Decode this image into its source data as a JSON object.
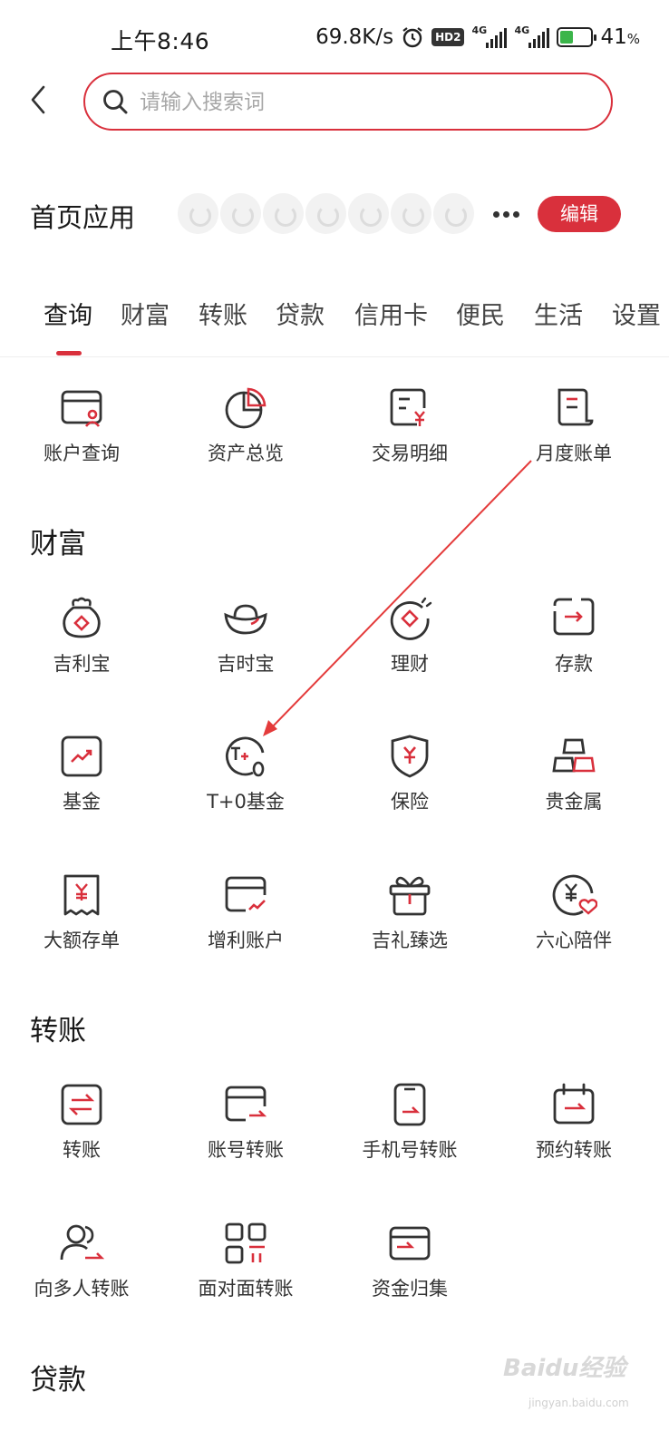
{
  "status_bar": {
    "time": "上午8:46",
    "net_speed": "69.8K/s",
    "hd_badge": "HD2",
    "signal_1_label": "4G",
    "signal_2_label": "4G",
    "battery_percent": "41",
    "battery_unit": "%",
    "battery_level": 0.41
  },
  "search": {
    "placeholder": "请输入搜索词"
  },
  "home_apps": {
    "title": "首页应用",
    "edit_label": "编辑"
  },
  "tabs": [
    {
      "label": "查询"
    },
    {
      "label": "财富"
    },
    {
      "label": "转账"
    },
    {
      "label": "贷款"
    },
    {
      "label": "信用卡"
    },
    {
      "label": "便民"
    },
    {
      "label": "生活"
    },
    {
      "label": "设置"
    }
  ],
  "query_section": {
    "items": [
      {
        "label": "账户查询",
        "icon": "account-query-icon"
      },
      {
        "label": "资产总览",
        "icon": "pie-chart-icon"
      },
      {
        "label": "交易明细",
        "icon": "transaction-detail-icon"
      },
      {
        "label": "月度账单",
        "icon": "monthly-bill-icon"
      }
    ]
  },
  "wealth_section": {
    "title": "财富",
    "items": [
      {
        "label": "吉利宝",
        "icon": "money-bag-icon"
      },
      {
        "label": "吉时宝",
        "icon": "gold-ingot-icon"
      },
      {
        "label": "理财",
        "icon": "finance-icon"
      },
      {
        "label": "存款",
        "icon": "deposit-icon"
      },
      {
        "label": "基金",
        "icon": "fund-icon"
      },
      {
        "label": "T+0基金",
        "icon": "t0-fund-icon"
      },
      {
        "label": "保险",
        "icon": "insurance-shield-icon"
      },
      {
        "label": "贵金属",
        "icon": "precious-metal-icon"
      },
      {
        "label": "大额存单",
        "icon": "large-deposit-icon"
      },
      {
        "label": "增利账户",
        "icon": "profit-account-icon"
      },
      {
        "label": "吉礼臻选",
        "icon": "gift-icon"
      },
      {
        "label": "六心陪伴",
        "icon": "heart-yuan-icon"
      }
    ]
  },
  "transfer_section": {
    "title": "转账",
    "items": [
      {
        "label": "转账",
        "icon": "transfer-icon"
      },
      {
        "label": "账号转账",
        "icon": "account-transfer-icon"
      },
      {
        "label": "手机号转账",
        "icon": "phone-transfer-icon"
      },
      {
        "label": "预约转账",
        "icon": "scheduled-transfer-icon"
      },
      {
        "label": "向多人转账",
        "icon": "multi-transfer-icon"
      },
      {
        "label": "面对面转账",
        "icon": "qr-transfer-icon"
      },
      {
        "label": "资金归集",
        "icon": "fund-collection-icon"
      }
    ]
  },
  "loan_section": {
    "title": "贷款"
  },
  "watermark": {
    "text": "Baidu经验",
    "sub": "jingyan.baidu.com"
  },
  "colors": {
    "accent": "#d9303c",
    "icon_stroke": "#333333"
  }
}
